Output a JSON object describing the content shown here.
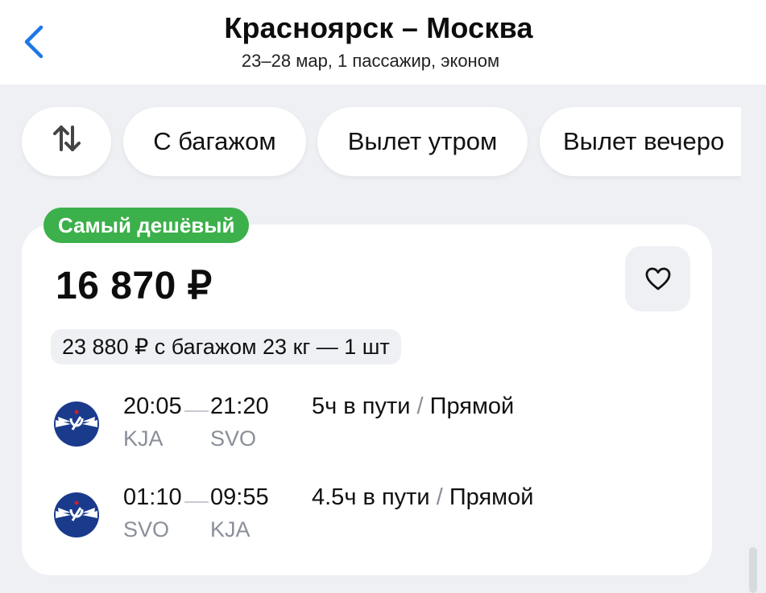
{
  "header": {
    "title": "Красноярск – Москва",
    "subtitle": "23–28 мар, 1 пассажир, эконом"
  },
  "filters": {
    "chips": [
      {
        "icon": "sort-icon"
      },
      {
        "label": "С багажом"
      },
      {
        "label": "Вылет утром"
      },
      {
        "label": "Вылет вечеро"
      }
    ]
  },
  "offer": {
    "badge": "Самый дешёвый",
    "price": "16 870 ₽",
    "baggage_offer": "23 880 ₽ с багажом 23 кг — 1 шт",
    "favorite_icon": "heart-icon",
    "segments": [
      {
        "airline_logo": "aeroflot-logo-icon",
        "departure_time": "20:05",
        "arrival_time": "21:20",
        "departure_code": "KJA",
        "arrival_code": "SVO",
        "duration": "5ч в пути",
        "separator": "/",
        "type": "Прямой"
      },
      {
        "airline_logo": "aeroflot-logo-icon",
        "departure_time": "01:10",
        "arrival_time": "09:55",
        "departure_code": "SVO",
        "arrival_code": "KJA",
        "duration": "4.5ч в пути",
        "separator": "/",
        "type": "Прямой"
      }
    ]
  },
  "colors": {
    "accent": "#1e78e6",
    "badge": "#3cb04b",
    "background": "#eef0f4",
    "muted_text": "#8a8f98",
    "airline": "#1a3a8c"
  }
}
